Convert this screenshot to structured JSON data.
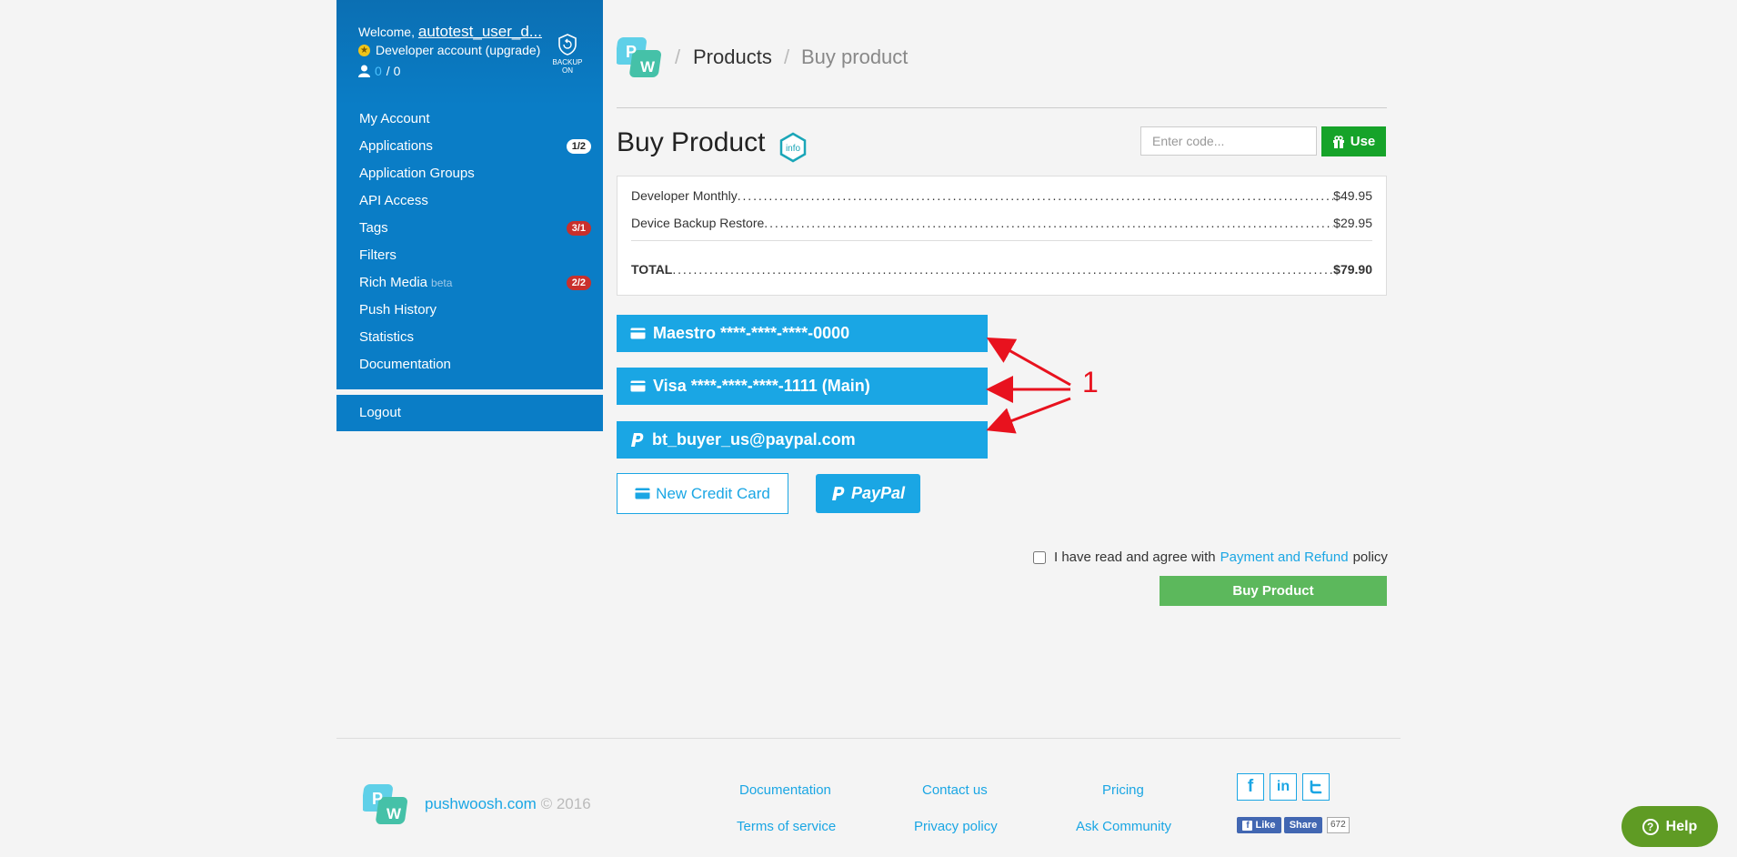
{
  "sidebar": {
    "welcome_prefix": "Welcome,",
    "username": "autotest_user_d...",
    "account_type": "Developer account (upgrade)",
    "user_count_active": "0",
    "user_count_sep": "/ 0",
    "backup_label_1": "BACKUP",
    "backup_label_2": "ON",
    "items": [
      {
        "label": "My Account"
      },
      {
        "label": "Applications",
        "badge": "1/2"
      },
      {
        "label": "Application Groups"
      },
      {
        "label": "API Access"
      },
      {
        "label": "Tags",
        "badge": "3/1"
      },
      {
        "label": "Filters"
      },
      {
        "label": "Rich Media",
        "suffix": "beta",
        "badge": "2/2"
      },
      {
        "label": "Push History"
      },
      {
        "label": "Statistics"
      },
      {
        "label": "Documentation"
      }
    ],
    "logout": "Logout"
  },
  "breadcrumb": {
    "sep": "/",
    "items": [
      "Products",
      "Buy product"
    ]
  },
  "page": {
    "title": "Buy Product",
    "info_icon_text": "info"
  },
  "promo": {
    "placeholder": "Enter code...",
    "use_label": "Use"
  },
  "order": {
    "items": [
      {
        "name": "Developer Monthly",
        "price": "$49.95"
      },
      {
        "name": "Device Backup Restore",
        "price": "$29.95"
      }
    ],
    "total_label": "TOTAL",
    "total": "$79.90"
  },
  "payment_methods": [
    {
      "icon": "credit-card-icon",
      "label": "Maestro ****-****-****-0000"
    },
    {
      "icon": "credit-card-icon",
      "label": "Visa ****-****-****-1111 (Main)"
    },
    {
      "icon": "paypal-icon",
      "label": "bt_buyer_us@paypal.com"
    }
  ],
  "annotation": {
    "label": "1",
    "color": "#e8121e"
  },
  "new_card_label": "New Credit Card",
  "paypal_label": "PayPal",
  "agree": {
    "prefix": "I have read and agree with",
    "link": "Payment and Refund",
    "suffix": "policy"
  },
  "buy_label": "Buy Product",
  "footer": {
    "brand": "pushwoosh.com",
    "copyright": "© 2016",
    "links": [
      "Documentation",
      "Contact us",
      "Pricing",
      "Terms of service",
      "Privacy policy",
      "Ask Community"
    ],
    "fb_like": "Like",
    "fb_share": "Share",
    "share_count": "672"
  },
  "help_label": "Help",
  "colors": {
    "sidebar": "#0a7dc6",
    "accent": "#1aa6e4",
    "buy": "#5cb85c",
    "use": "#16a329",
    "help": "#5f9b24"
  }
}
